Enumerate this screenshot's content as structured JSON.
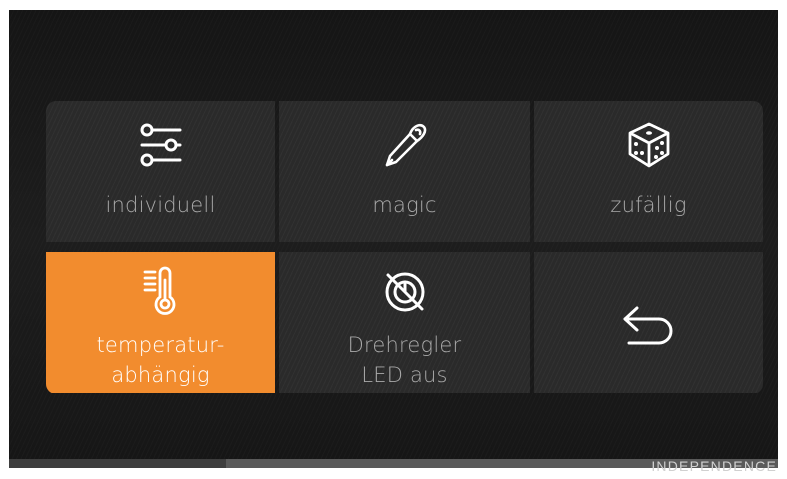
{
  "tiles": {
    "individuell": {
      "label": "individuell",
      "icon": "sliders-icon",
      "active": false
    },
    "magic": {
      "label": "magic",
      "icon": "pen-icon",
      "active": false
    },
    "zufaellig": {
      "label": "zufällig",
      "icon": "dice-icon",
      "active": false
    },
    "temperatur": {
      "label_line1": "temperatur-",
      "label_line2": "abhängig",
      "icon": "thermometer-icon",
      "active": true
    },
    "drehregler": {
      "label_line1": "Drehregler",
      "label_line2": "LED aus",
      "icon": "knob-off-icon",
      "active": false
    },
    "back": {
      "icon": "back-arrow-icon",
      "active": false
    }
  },
  "footer": {
    "brand": "INDEPENDENCE"
  },
  "colors": {
    "accent": "#f28c2e",
    "tile": "#2a2a2a",
    "text_inactive": "#a9a9a9",
    "text_active": "#ffffff"
  }
}
